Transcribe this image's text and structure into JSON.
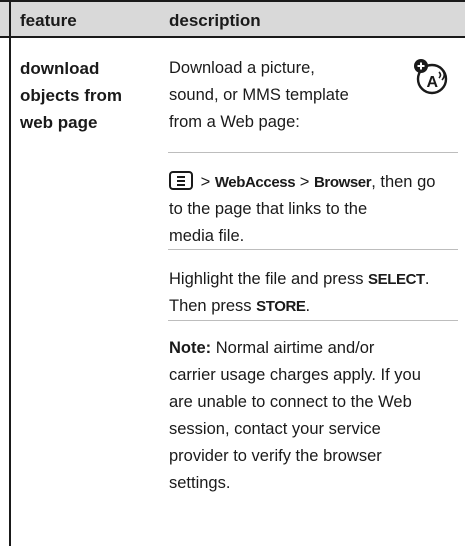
{
  "header": {
    "feature_label": "feature",
    "description_label": "description"
  },
  "row": {
    "feature_lines": [
      "download",
      "objects from",
      "web page"
    ],
    "intro_lines": [
      "Download a picture,",
      "sound, or MMS template",
      "from a Web page:"
    ],
    "nav": {
      "menu_icon": "menu-key-icon",
      "sep1": " > ",
      "webaccess": "WebAccess",
      "sep2": " > ",
      "browser": "Browser",
      "tail_1": ", then go",
      "line2": "to the page that links to the",
      "line3": "media file."
    },
    "select": {
      "pre": "Highlight the file and press ",
      "key1": "SELECT",
      "post1": ".",
      "pre2": "Then press ",
      "key2": "STORE",
      "post2": "."
    },
    "note": {
      "label": "Note:",
      "line1": " Normal airtime and/or",
      "line2": "carrier usage charges apply. If you",
      "line3": "are unable to connect to the Web",
      "line4": "session, contact your service",
      "line5": "provider to verify the browser",
      "line6": "settings."
    },
    "icon": "network-dependent-feature-icon"
  }
}
